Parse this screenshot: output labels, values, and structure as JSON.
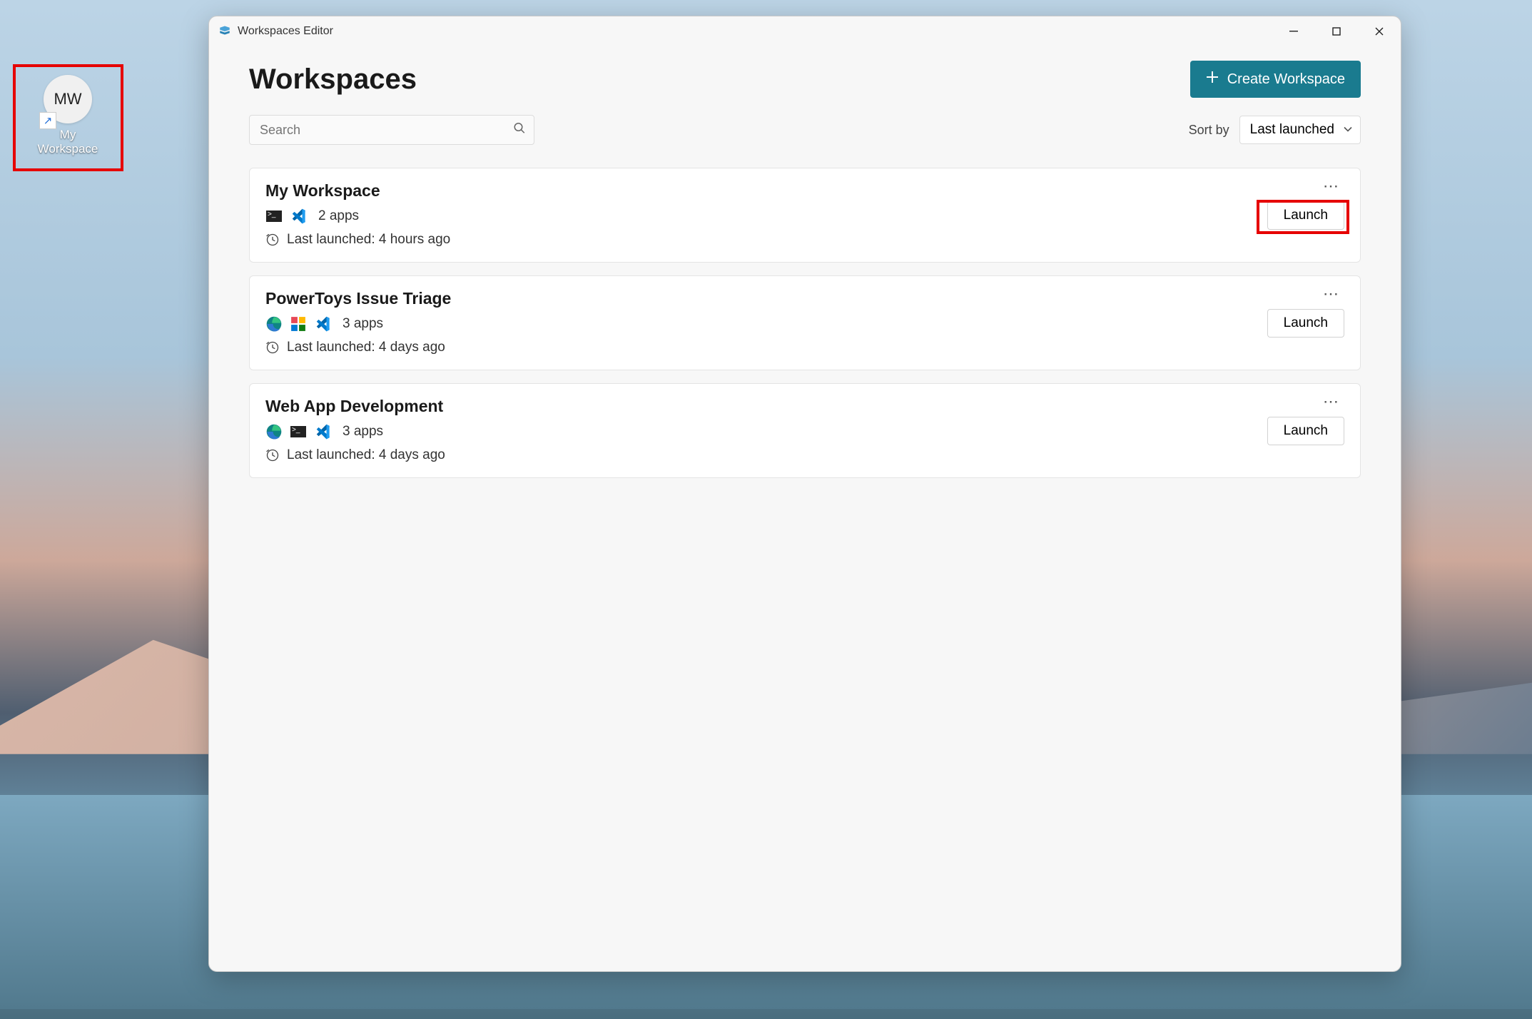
{
  "desktop_shortcut": {
    "initials": "MW",
    "label_line1": "My",
    "label_line2": "Workspace"
  },
  "window": {
    "title": "Workspaces Editor"
  },
  "header": {
    "page_title": "Workspaces",
    "create_button": "Create Workspace"
  },
  "search": {
    "placeholder": "Search"
  },
  "sort": {
    "label": "Sort by",
    "selected": "Last launched"
  },
  "launch_label": "Launch",
  "workspaces": [
    {
      "name": "My Workspace",
      "apps_count": "2 apps",
      "last_launched": "Last launched: 4 hours ago",
      "icons": [
        "cmd",
        "vscode"
      ],
      "highlighted": true
    },
    {
      "name": "PowerToys Issue Triage",
      "apps_count": "3 apps",
      "last_launched": "Last launched: 4 days ago",
      "icons": [
        "edge",
        "pt",
        "vscode"
      ],
      "highlighted": false
    },
    {
      "name": "Web App Development",
      "apps_count": "3 apps",
      "last_launched": "Last launched: 4 days ago",
      "icons": [
        "edge",
        "cmd",
        "vscode"
      ],
      "highlighted": false
    }
  ]
}
